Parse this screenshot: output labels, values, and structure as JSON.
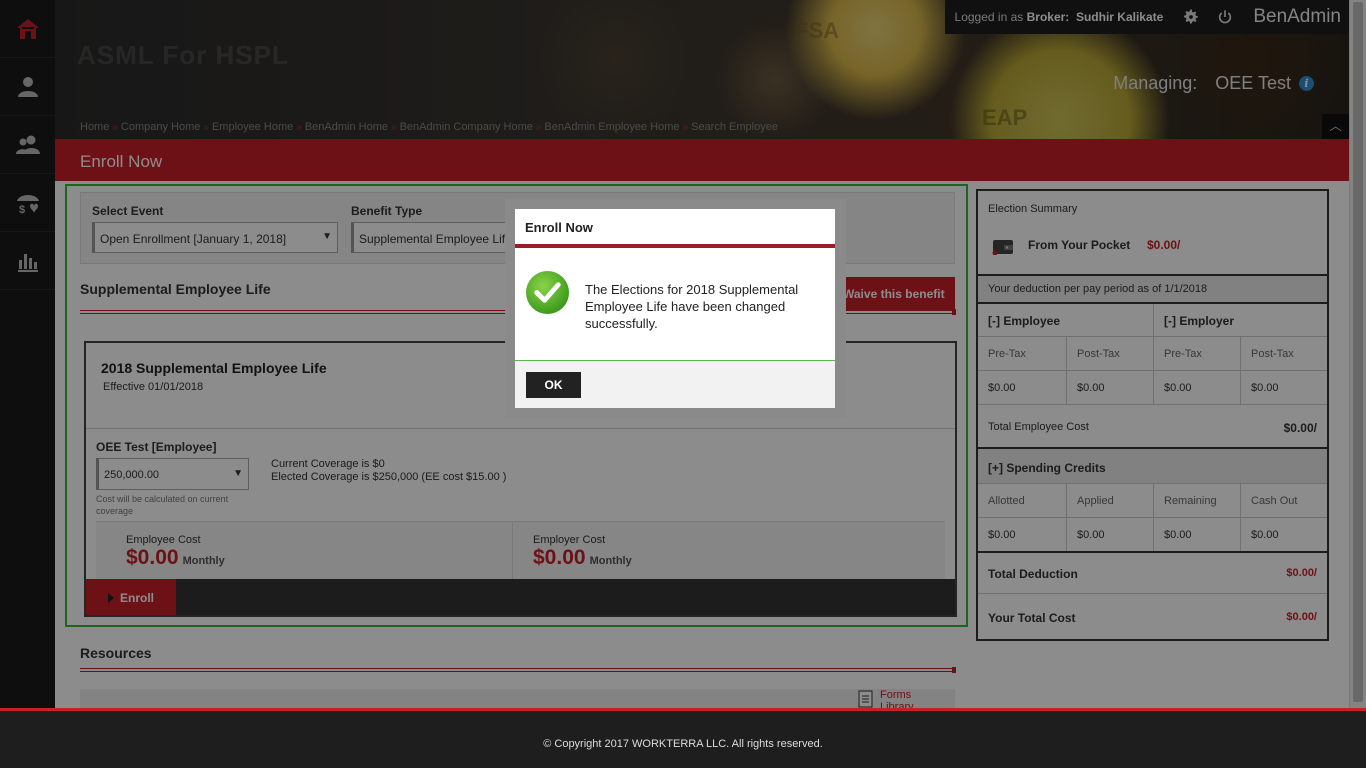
{
  "header": {
    "brand_ghost": "ASML For HSPL",
    "coin_text_1": "FSA",
    "coin_text_2": "EAP",
    "login_prefix": "Logged in as",
    "login_role": "Broker:",
    "login_user": "Sudhir Kalikate",
    "app_name": "BenAdmin",
    "managing_label": "Managing:",
    "managing_value": "OEE Test",
    "breadcrumb": [
      "Home",
      "Company Home",
      "Employee Home",
      "BenAdmin Home",
      "BenAdmin Company Home",
      "BenAdmin Employee Home",
      "Search Employee"
    ],
    "breadcrumb_sep": "»"
  },
  "leftnav": {
    "items": [
      "home-icon",
      "person-icon",
      "people-icon",
      "benefits-umbrella-icon",
      "reports-chart-icon"
    ]
  },
  "page": {
    "title": "Enroll Now"
  },
  "enroll": {
    "select_event_label": "Select Event",
    "select_event_value": "Open Enrollment [January 1, 2018]",
    "benefit_type_label": "Benefit Type",
    "benefit_type_value": "Supplemental Employee Life",
    "section_title": "Supplemental Employee Life",
    "waive_button": "Waive this benefit",
    "plan_name": "2018 Supplemental Employee Life",
    "effective": "Effective 01/01/2018",
    "member": "OEE Test [Employee]",
    "coverage_value": "250,000.00",
    "coverage_note": "Cost will be calculated on current coverage",
    "current_coverage": "Current Coverage is $0",
    "elected_coverage": "Elected Coverage is $250,000 (EE cost $15.00 )",
    "employee_cost_label": "Employee Cost",
    "employee_cost_value": "$0.00",
    "employee_cost_period": "Monthly",
    "employer_cost_label": "Employer Cost",
    "employer_cost_value": "$0.00",
    "employer_cost_period": "Monthly",
    "enroll_button": "Enroll"
  },
  "resources": {
    "title": "Resources",
    "forms_link": "Forms Library"
  },
  "summary": {
    "title": "Election Summary",
    "pocket_label": "From Your Pocket",
    "pocket_value": "$0.00/",
    "deduction_note": "Your deduction per pay period as of 1/1/2018",
    "employee_header": "[-] Employee",
    "employer_header": "[-] Employer",
    "cols": [
      "Pre-Tax",
      "Post-Tax",
      "Pre-Tax",
      "Post-Tax"
    ],
    "values": [
      "$0.00",
      "$0.00",
      "$0.00",
      "$0.00"
    ],
    "total_employee_cost_label": "Total Employee Cost",
    "total_employee_cost_value": "$0.00/",
    "spending_header": "[+] Spending Credits",
    "spending_cols": [
      "Allotted",
      "Applied",
      "Remaining",
      "Cash Out"
    ],
    "spending_values": [
      "$0.00",
      "$0.00",
      "$0.00",
      "$0.00"
    ],
    "total_deduction_label": "Total Deduction",
    "total_deduction_value": "$0.00/",
    "total_cost_label": "Your Total Cost",
    "total_cost_value": "$0.00/"
  },
  "footer": {
    "copyright": "© Copyright 2017 WORKTERRA LLC. All rights reserved."
  },
  "modal": {
    "title": "Enroll Now",
    "message": "The Elections for 2018 Supplemental Employee Life have been changed successfully.",
    "ok_button": "OK"
  },
  "colors": {
    "brand_red": "#c8202b",
    "success_green": "#35b43e"
  }
}
